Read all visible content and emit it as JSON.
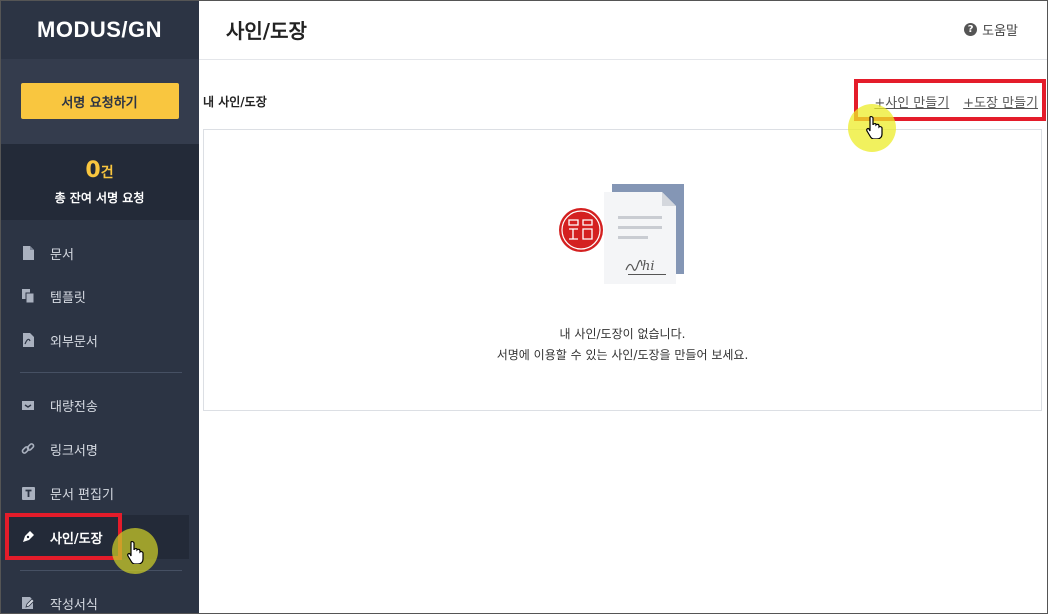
{
  "sidebar": {
    "logo": "MODUS/GN",
    "request_button": "서명 요청하기",
    "count_value": "0",
    "count_unit": "건",
    "count_label": "총 잔여 서명 요청",
    "items": [
      {
        "label": "문서",
        "icon": "document-icon"
      },
      {
        "label": "템플릿",
        "icon": "copy-icon"
      },
      {
        "label": "외부문서",
        "icon": "pdf-file-icon"
      },
      {
        "label": "대량전송",
        "icon": "inbox-icon"
      },
      {
        "label": "링크서명",
        "icon": "link-icon"
      },
      {
        "label": "문서 편집기",
        "icon": "text-editor-icon"
      },
      {
        "label": "사인/도장",
        "icon": "pen-nib-icon",
        "active": true
      },
      {
        "label": "작성서식",
        "icon": "form-edit-icon"
      }
    ]
  },
  "header": {
    "title": "사인/도장",
    "help": "도움말"
  },
  "section": {
    "title": "내 사인/도장",
    "add_sign": "+사인 만들기",
    "add_stamp": "+도장 만들기"
  },
  "empty": {
    "line1": "내 사인/도장이 없습니다.",
    "line2": "서명에 이용할 수 있는 사인/도장을 만들어 보세요.",
    "signature_text": "hi"
  },
  "colors": {
    "sidebar_bg": "#2c3444",
    "accent": "#f9c63f",
    "annotation_red": "#e41c2a",
    "stamp_red": "#d42020",
    "doc_blue": "#8496b5"
  }
}
